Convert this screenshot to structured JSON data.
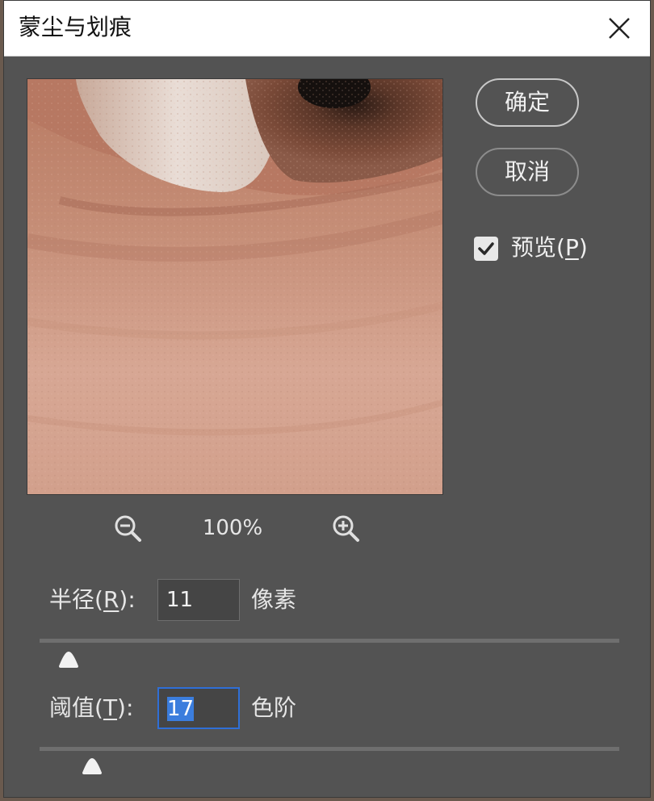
{
  "window": {
    "title": "蒙尘与划痕",
    "close_icon": "close-icon"
  },
  "buttons": {
    "ok": "确定",
    "cancel": "取消"
  },
  "preview": {
    "checkbox_checked": true,
    "label_prefix": "预览(",
    "label_key": "P",
    "label_suffix": ")"
  },
  "zoom": {
    "value": "100%",
    "zoom_out_icon": "zoom-out-icon",
    "zoom_in_icon": "zoom-in-icon"
  },
  "radius": {
    "label_prefix": "半径(",
    "label_key": "R",
    "label_suffix": "):",
    "value": "11",
    "unit": "像素",
    "slider_fraction": 0.05
  },
  "threshold": {
    "label_prefix": "阈值(",
    "label_key": "T",
    "label_suffix": "):",
    "value": "17",
    "unit": "色阶",
    "slider_fraction": 0.09,
    "value_selected": true
  },
  "colors": {
    "dialog_bg": "#535353",
    "focus_border": "#2f6fd6",
    "selection": "#3b7ddd"
  }
}
